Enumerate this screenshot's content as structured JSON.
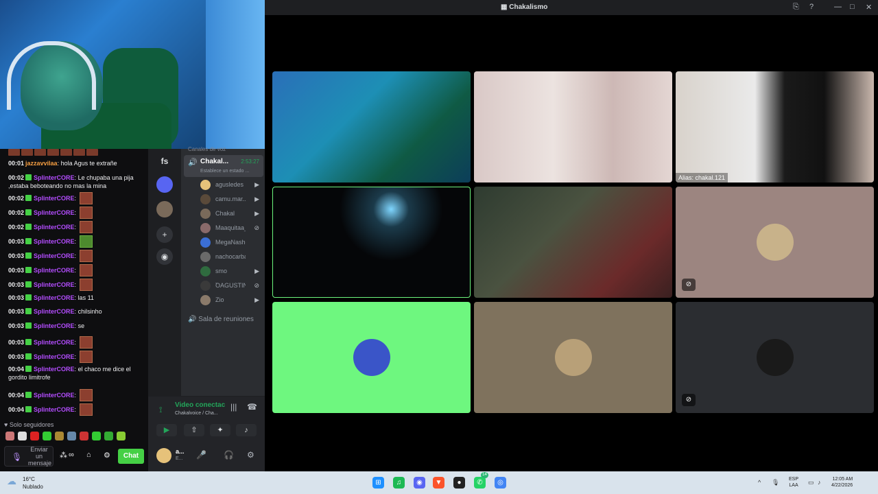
{
  "window": {
    "title": "Chakalismo",
    "icon": "discord-icon"
  },
  "webcam": {
    "label": ""
  },
  "chat": {
    "messages": [
      {
        "time": "00:01",
        "user": "jazzavvilaa",
        "user_color": "#f59e42",
        "badge": false,
        "text": "hola Agus te extrañe",
        "emote": false
      },
      {
        "time": "00:02",
        "user": "SplinterCORE",
        "user_color": "#b44dff",
        "badge": true,
        "text": "Le chupaba una pija ,estaba beboteando no mas la mina",
        "emote": false
      },
      {
        "time": "00:02",
        "user": "SplinterCORE",
        "user_color": "#b44dff",
        "badge": true,
        "text": "",
        "emote": true
      },
      {
        "time": "00:02",
        "user": "SplinterCORE",
        "user_color": "#b44dff",
        "badge": true,
        "text": "",
        "emote": true
      },
      {
        "time": "00:02",
        "user": "SplinterCORE",
        "user_color": "#b44dff",
        "badge": true,
        "text": "",
        "emote": true
      },
      {
        "time": "00:03",
        "user": "SplinterCORE",
        "user_color": "#b44dff",
        "badge": true,
        "text": "",
        "emote": true,
        "emote_style": "green"
      },
      {
        "time": "00:03",
        "user": "SplinterCORE",
        "user_color": "#b44dff",
        "badge": true,
        "text": "",
        "emote": true
      },
      {
        "time": "00:03",
        "user": "SplinterCORE",
        "user_color": "#b44dff",
        "badge": true,
        "text": "",
        "emote": true
      },
      {
        "time": "00:03",
        "user": "SplinterCORE",
        "user_color": "#b44dff",
        "badge": true,
        "text": "",
        "emote": true
      },
      {
        "time": "00:03",
        "user": "SplinterCORE",
        "user_color": "#b44dff",
        "badge": true,
        "text": "las 11",
        "emote": false
      },
      {
        "time": "00:03",
        "user": "SplinterCORE",
        "user_color": "#b44dff",
        "badge": true,
        "text": "chilsinho",
        "emote": false
      },
      {
        "time": "00:03",
        "user": "SplinterCORE",
        "user_color": "#b44dff",
        "badge": true,
        "text": "se",
        "emote": false
      },
      {
        "time": "00:03",
        "user": "SplinterCORE",
        "user_color": "#b44dff",
        "badge": true,
        "text": "",
        "emote": true
      },
      {
        "time": "00:03",
        "user": "SplinterCORE",
        "user_color": "#b44dff",
        "badge": true,
        "text": "",
        "emote": true
      },
      {
        "time": "00:04",
        "user": "SplinterCORE",
        "user_color": "#b44dff",
        "badge": true,
        "text": "el chaco me dice el gordito limitrofe",
        "emote": false
      },
      {
        "time": "00:04",
        "user": "SplinterCORE",
        "user_color": "#b44dff",
        "badge": true,
        "text": "",
        "emote": true
      },
      {
        "time": "00:04",
        "user": "SplinterCORE",
        "user_color": "#b44dff",
        "badge": true,
        "text": "",
        "emote": true
      }
    ],
    "followers_only": "Solo seguidores",
    "input_placeholder": "Enviar un mensaje",
    "chat_button": "Chat"
  },
  "guilds": {
    "current": "fs"
  },
  "channels": {
    "section_header": "Canales de voz",
    "active_voice": {
      "name": "Chakal...",
      "timer": "2:53:27",
      "status": "Establece un estado ..."
    },
    "voice_users": [
      {
        "name": "agusledes",
        "color": "#e6c27a",
        "icon": "video-icon"
      },
      {
        "name": "camu.mar...",
        "color": "#5a4a3a",
        "icon": "video-icon"
      },
      {
        "name": "Chakal",
        "color": "#7a6a5a",
        "icon": "video-icon"
      },
      {
        "name": "Maaquitaa_",
        "color": "#8a6a6a",
        "icon": "muted-icon"
      },
      {
        "name": "MegaNashe",
        "color": "#3b6fd6",
        "icon": ""
      },
      {
        "name": "nachocarba",
        "color": "#6a6a6a",
        "icon": ""
      },
      {
        "name": "smo",
        "color": "#2f6b3f",
        "icon": "video-icon"
      },
      {
        "name": "ꝹAGUSTIN...",
        "color": "#3a3a3a",
        "icon": "muted-icon"
      },
      {
        "name": "Zio",
        "color": "#8a7a6a",
        "icon": "video-icon"
      }
    ],
    "other_voice": "Sala de reuniones"
  },
  "voicebar": {
    "title": "Video conectac",
    "subtitle": "Chakalvoice / Cha..."
  },
  "userbar": {
    "name": "a...",
    "status": "E..."
  },
  "tiles": [
    {
      "type": "video",
      "theme": "blue-room",
      "alias": ""
    },
    {
      "type": "video",
      "theme": "curtain-girl",
      "alias": ""
    },
    {
      "type": "video",
      "theme": "cap-boy",
      "alias": "Alias: chakal.121"
    },
    {
      "type": "video",
      "theme": "dark-room",
      "alias": "",
      "speaking": true
    },
    {
      "type": "video",
      "theme": "graffiti-room",
      "alias": ""
    },
    {
      "type": "avatar",
      "bg": "#9c8580",
      "avatar_color": "#c8b28a",
      "muted": true
    },
    {
      "type": "avatar",
      "bg": "#6ef77f",
      "avatar_color": "#3a55c8",
      "muted": false
    },
    {
      "type": "avatar",
      "bg": "#7f725d",
      "avatar_color": "#b8a078",
      "muted": false
    },
    {
      "type": "avatar",
      "bg": "#2b2d31",
      "avatar_color": "#1a1a1a",
      "muted": true
    }
  ],
  "taskbar": {
    "temp": "16°C",
    "condition": "Nublado",
    "lang_top": "ESP",
    "lang_bottom": "LAA",
    "time": "12:05 AM",
    "date": "4/22/2026",
    "badge_count": "14"
  }
}
